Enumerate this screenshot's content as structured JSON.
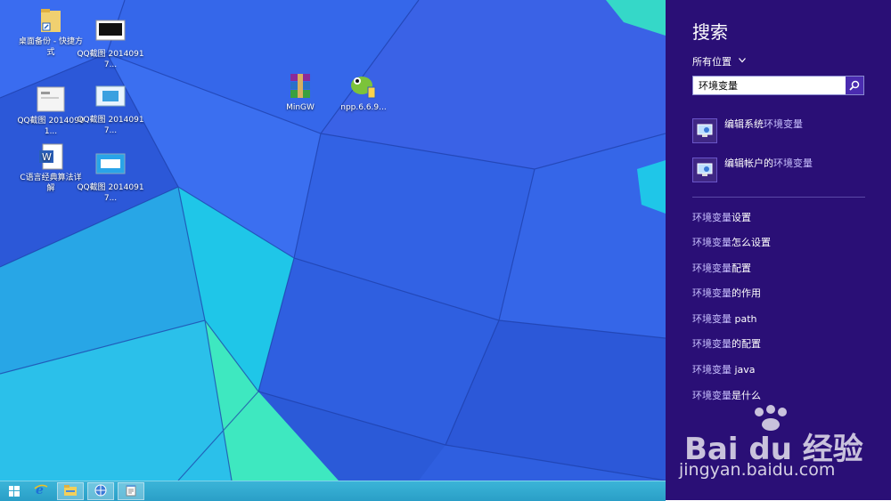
{
  "desktop": {
    "icons": [
      {
        "label": "桌面备份 - 快捷方式"
      },
      {
        "label": "QQ截图 20140917..."
      },
      {
        "label": "QQ截图 20140901..."
      },
      {
        "label": "QQ截图 20140917..."
      },
      {
        "label": "C语言经典算法详解"
      },
      {
        "label": "QQ截图 20140917..."
      },
      {
        "label": "MinGW"
      },
      {
        "label": "npp.6.6.9..."
      }
    ]
  },
  "taskbar": {
    "items": [
      "windows-logo-icon",
      "internet-explorer-icon",
      "file-explorer-icon",
      "globe-icon",
      "notepad-icon"
    ]
  },
  "charm": {
    "title": "搜索",
    "scope": "所有位置",
    "search_value": "环境变量",
    "settings": [
      {
        "prefix": "编辑系统",
        "highlight": "环境变量"
      },
      {
        "prefix": "编辑帐户的",
        "highlight": "环境变量"
      }
    ],
    "suggestions": [
      {
        "match": "环境变量",
        "rest": "设置"
      },
      {
        "match": "环境变量",
        "rest": "怎么设置"
      },
      {
        "match": "环境变量",
        "rest": "配置"
      },
      {
        "match": "环境变量",
        "rest": "的作用"
      },
      {
        "match": "环境变量",
        "rest": " path"
      },
      {
        "match": "环境变量",
        "rest": "的配置"
      },
      {
        "match": "环境变量",
        "rest": " java"
      },
      {
        "match": "环境变量",
        "rest": "是什么"
      }
    ]
  },
  "watermark": {
    "logo": "Bai du 经验",
    "url": "jingyan.baidu.com"
  },
  "colors": {
    "charm_bg": "#2a0f76",
    "wallpaper_blue": "#2f5fe0",
    "wallpaper_cyan": "#1fc6e8",
    "wallpaper_green": "#3ee8c0"
  }
}
